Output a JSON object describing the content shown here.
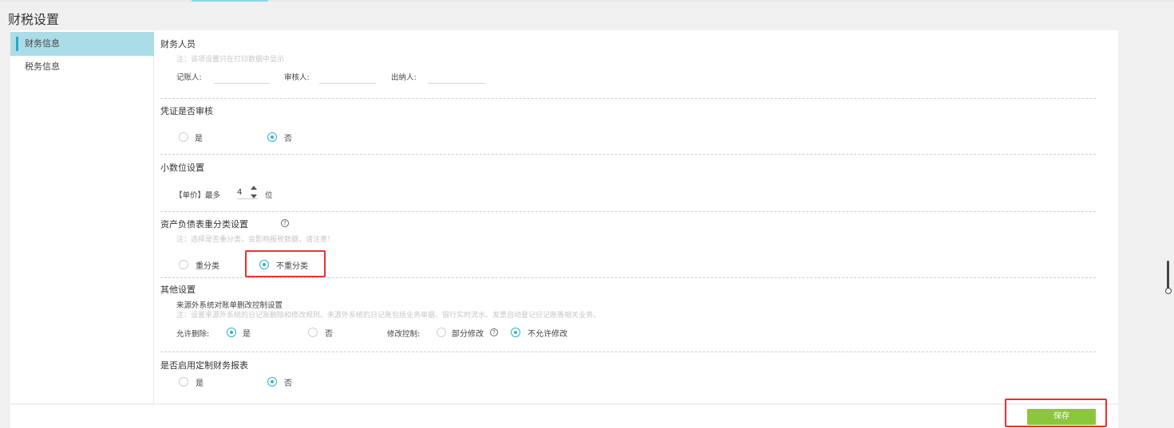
{
  "page": {
    "title": "财税设置"
  },
  "sidebar": {
    "items": [
      {
        "label": "财务信息"
      },
      {
        "label": "税务信息"
      }
    ]
  },
  "finance_staff": {
    "title": "财务人员",
    "note": "注：该项设置只在打印数据中显示",
    "bookkeeper_label": "记账人:",
    "reviewer_label": "审核人:",
    "cashier_label": "出纳人:",
    "bookkeeper_value": "",
    "reviewer_value": "",
    "cashier_value": ""
  },
  "voucher_review": {
    "title": "凭证是否审核",
    "yes_label": "是",
    "no_label": "否",
    "selected": "否"
  },
  "decimal": {
    "title": "小数位设置",
    "prefix": "【单价】最多",
    "value": "4",
    "suffix": "位"
  },
  "balance_sheet": {
    "title": "资产负债表重分类设置",
    "help_glyph": "?",
    "note": "注：选择是否重分类，会影响报税数据，请注意！",
    "option_reclass": "重分类",
    "option_no_reclass": "不重分类",
    "selected": "不重分类"
  },
  "other": {
    "title": "其他设置",
    "subtitle": "来源外系统对账单删改控制设置",
    "note": "注：设置来源外系统的日记账删除和修改规则。来源外系统的日记账包括业务单据、银行实时流水、发票自动登记日记账等相关业务。",
    "allow_delete_label": "允许删除:",
    "delete_yes": "是",
    "delete_no": "否",
    "delete_selected": "是",
    "modify_label": "修改控制:",
    "modify_partial": "部分修改",
    "modify_none": "不允许修改",
    "modify_selected": "不允许修改",
    "help_glyph": "?"
  },
  "custom_report": {
    "title": "是否启用定制财务报表",
    "yes_label": "是",
    "no_label": "否",
    "selected": "否"
  },
  "actions": {
    "save_label": "保存"
  },
  "colors": {
    "accent": "#35b1d0",
    "save": "#8cc63f",
    "highlight": "#e8322f",
    "sidebar_active": "#aadde8"
  }
}
